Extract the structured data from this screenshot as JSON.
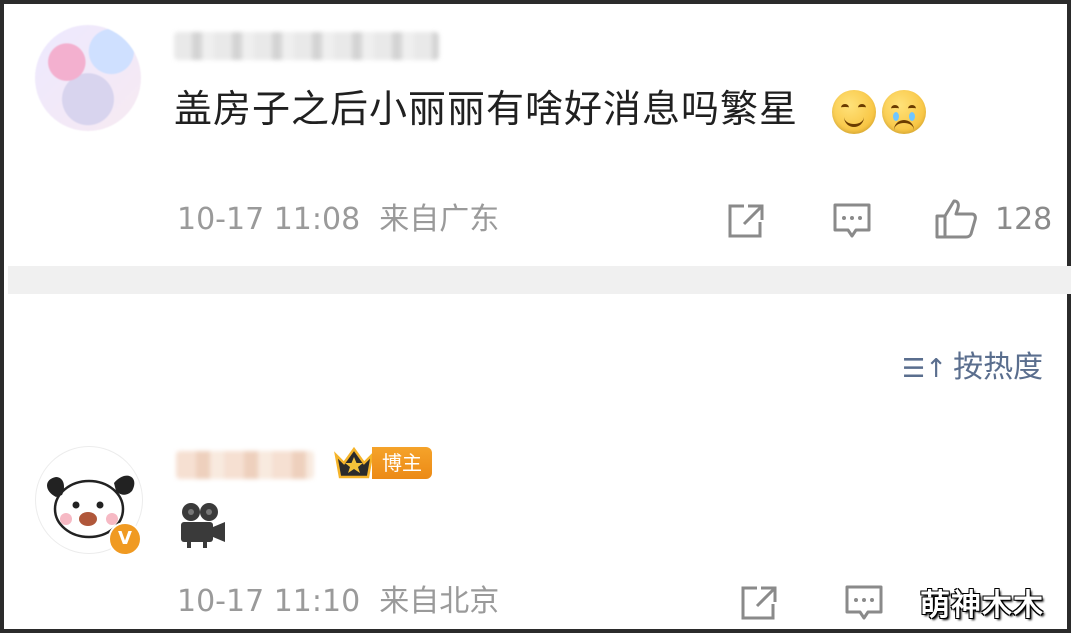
{
  "comment1": {
    "text": "盖房子之后小丽丽有啥好消息吗繁星",
    "emojis": [
      "grin-emoji",
      "teary-emoji"
    ],
    "time": "10-17 11:08",
    "location": "来自广东",
    "likes": "128"
  },
  "sort": {
    "label": "按热度"
  },
  "comment2": {
    "badge": "博主",
    "time": "10-17 11:10",
    "location": "来自北京"
  },
  "watermark": "萌神木木",
  "colors": {
    "meta": "#9a9a9a",
    "sort": "#5a6e8e",
    "badge": "#ec8a16",
    "divider": "#f0f0f0"
  }
}
